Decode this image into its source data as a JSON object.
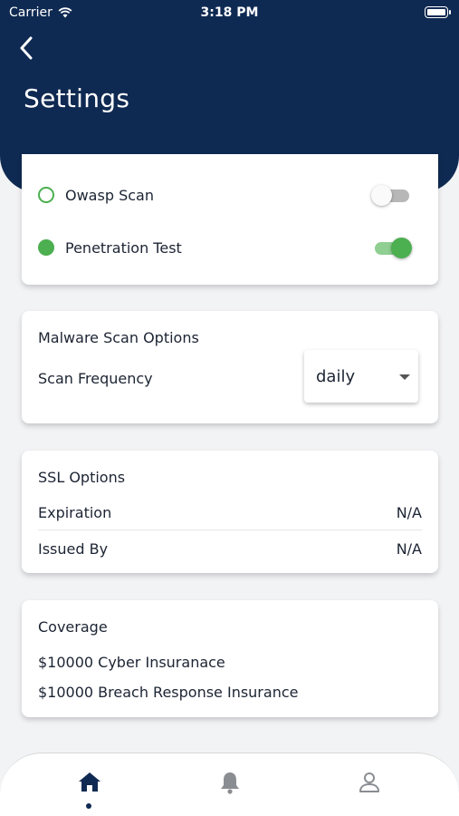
{
  "status_bar": {
    "carrier": "Carrier",
    "time": "3:18 PM"
  },
  "header": {
    "title": "Settings",
    "back_icon": "chevron-left-icon"
  },
  "scans": [
    {
      "label": "Owasp Scan",
      "enabled": false
    },
    {
      "label": "Penetration Test",
      "enabled": true
    }
  ],
  "malware": {
    "title": "Malware Scan Options",
    "frequency_label": "Scan Frequency",
    "frequency_value": "daily"
  },
  "ssl": {
    "title": "SSL Options",
    "rows": [
      {
        "label": "Expiration",
        "value": "N/A"
      },
      {
        "label": "Issued By",
        "value": "N/A"
      }
    ]
  },
  "coverage": {
    "title": "Coverage",
    "items": [
      "$10000 Cyber Insuranace",
      "$10000 Breach Response Insurance"
    ]
  },
  "tabbar": {
    "tabs": [
      "home-icon",
      "bell-icon",
      "user-icon"
    ],
    "active": "home-icon"
  },
  "colors": {
    "header": "#0f2a52",
    "accent_green": "#4caf50",
    "background": "#f2f3f5"
  }
}
